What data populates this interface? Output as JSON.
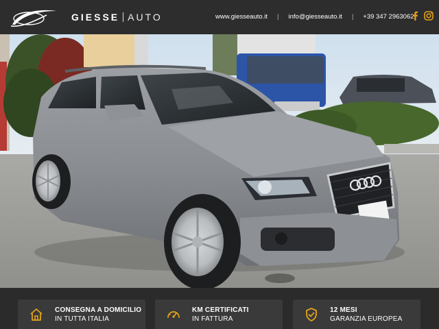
{
  "header": {
    "brand_primary": "GIESSE",
    "brand_secondary": "AUTO",
    "website": "www.giesseauto.it",
    "email": "info@giesseauto.it",
    "phone": "+39 347 2963062",
    "separator": "|"
  },
  "social": {
    "icons": [
      "facebook-icon",
      "instagram-icon"
    ],
    "accent_color": "#e3a21a"
  },
  "photo": {
    "plate_text": ""
  },
  "features": [
    {
      "icon": "house-icon",
      "title": "CONSEGNA A DOMICILIO",
      "subtitle": "IN TUTTA ITALIA"
    },
    {
      "icon": "speedometer-icon",
      "title": "KM CERTIFICATI",
      "subtitle": "IN FATTURA"
    },
    {
      "icon": "shield-check-icon",
      "title": "12 MESI",
      "subtitle": "GARANZIA EUROPEA"
    }
  ],
  "colors": {
    "bar_bg": "#2d2d2d",
    "card_bg": "#3a3a3a",
    "icon_accent": "#e3a21a",
    "text": "#ffffff"
  }
}
